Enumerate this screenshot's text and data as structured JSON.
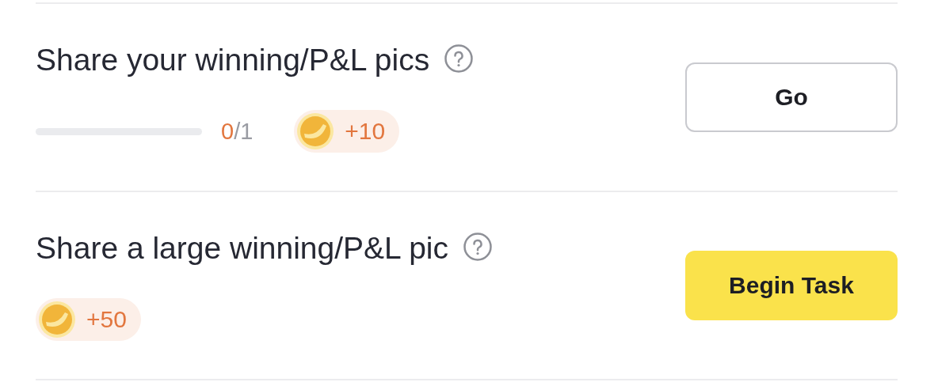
{
  "tasks": [
    {
      "title": "Share your winning/P&L pics",
      "progress": {
        "level": 0,
        "done": "0",
        "total": "/1"
      },
      "reward": "+10",
      "button": {
        "label": "Go",
        "kind": "outline"
      }
    },
    {
      "title": "Share a large winning/P&L pic",
      "reward": "+50",
      "button": {
        "label": "Begin Task",
        "kind": "primary"
      }
    }
  ]
}
